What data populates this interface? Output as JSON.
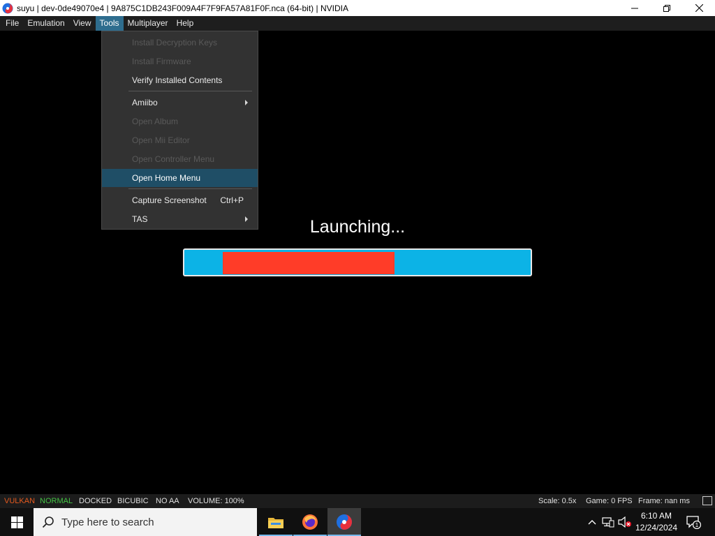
{
  "window": {
    "title": "suyu | dev-0de49070e4 | 9A875C1DB243F009A4F7F9FA57A81F0F.nca (64-bit) | NVIDIA",
    "controls": [
      "minimize-icon",
      "maximize-icon",
      "close-icon"
    ]
  },
  "menubar": {
    "items": [
      {
        "label": "File"
      },
      {
        "label": "Emulation"
      },
      {
        "label": "View"
      },
      {
        "label": "Tools",
        "active": true
      },
      {
        "label": "Multiplayer"
      },
      {
        "label": "Help"
      }
    ]
  },
  "tools_menu": {
    "items": [
      {
        "label": "Install Decryption Keys",
        "enabled": false
      },
      {
        "label": "Install Firmware",
        "enabled": false
      },
      {
        "label": "Verify Installed Contents",
        "enabled": true
      },
      {
        "label": "Amiibo",
        "enabled": true,
        "submenu": true
      },
      {
        "label": "Open Album",
        "enabled": false
      },
      {
        "label": "Open Mii Editor",
        "enabled": false
      },
      {
        "label": "Open Controller Menu",
        "enabled": false
      },
      {
        "label": "Open Home Menu",
        "enabled": true,
        "highlighted": true
      },
      {
        "label": "Capture Screenshot",
        "enabled": true,
        "shortcut": "Ctrl+P"
      },
      {
        "label": "TAS",
        "enabled": true,
        "submenu": true
      }
    ]
  },
  "loading": {
    "text": "Launching...",
    "progress_start": 0.11,
    "progress_end": 0.605,
    "colors": {
      "track": "#0cb3e6",
      "fill": "#ff3c28"
    }
  },
  "statusbar": {
    "renderer": "VULKAN",
    "renderer_color": "#e65a1e",
    "mode": "NORMAL",
    "mode_color": "#44c244",
    "dock": "DOCKED",
    "filter": "BICUBIC",
    "aa": "NO AA",
    "volume": "VOLUME: 100%",
    "scale": "Scale: 0.5x",
    "fps": "Game: 0 FPS",
    "frame": "Frame: nan ms"
  },
  "taskbar": {
    "search_placeholder": "Type here to search",
    "apps": [
      "file-explorer-icon",
      "firefox-icon",
      "suyu-icon"
    ],
    "time": "6:10 AM",
    "date": "12/24/2024",
    "notification_count": "1"
  }
}
